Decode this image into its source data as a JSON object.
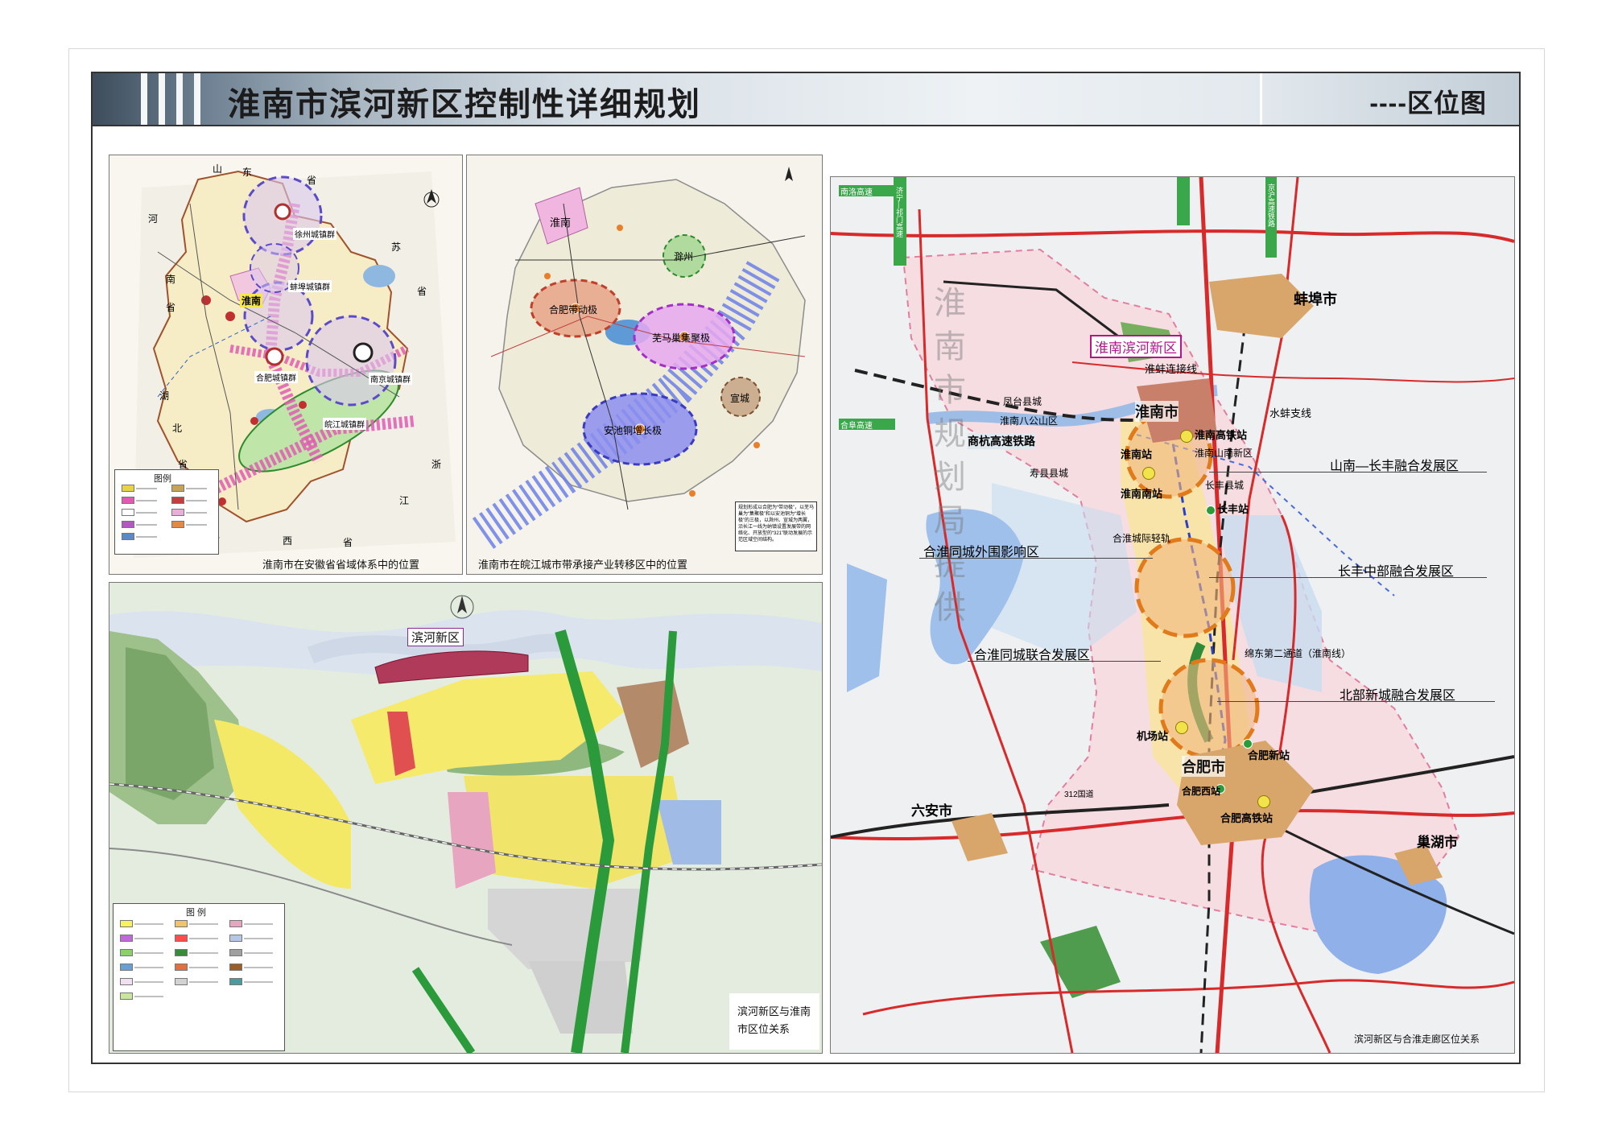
{
  "header": {
    "title": "淮南市滨河新区控制性详细规划",
    "subtitle": "----区位图"
  },
  "panel_province": {
    "caption": "淮南市在安徽省省域体系中的位置",
    "legend_title": "图例",
    "labels": {
      "shandong": "山",
      "dong": "东",
      "sheng1": "省",
      "henan1": "河",
      "henan2": "南",
      "sheng2": "省",
      "jiang1": "苏",
      "sheng3": "省",
      "hu": "湖",
      "bei": "北",
      "sheng4": "省",
      "zhe": "浙",
      "jiang2": "江",
      "jiangxi1": "江",
      "jiangxi2": "西",
      "sheng5": "省",
      "huainan": "淮南",
      "xuzhou": "徐州城镇群",
      "bengbu": "蚌埠城镇群",
      "hefei": "合肥城镇群",
      "nanjing": "南京城镇群",
      "wanjiang": "皖江城镇群"
    },
    "legend_items": [
      {
        "color": "#e8d24a"
      },
      {
        "color": "#c9a25a"
      },
      {
        "color": "#e05ab4"
      },
      {
        "color": "#c04040"
      },
      {
        "color": "#ffffff"
      },
      {
        "color": "#e6b0d8"
      },
      {
        "color": "#b05ac0"
      },
      {
        "color": "#e08a4a"
      },
      {
        "color": "#5a8ac0"
      }
    ]
  },
  "panel_wanjiang": {
    "caption": "淮南市在皖江城市带承接产业转移区中的位置",
    "labels": {
      "huainan": "淮南",
      "hefei_pole": "合肥带动极",
      "chuzhou": "滁州",
      "wuma": "芜马巢集聚极",
      "xuancheng": "宣城",
      "anchi": "安池铜增长极"
    },
    "note": "规划形成以合肥为“带动极”，以芜马巢为“集聚极”和以安池铜为“增长极”的三极，以滁州、宣城为两翼，沿长江一线为纳镇设置发展带的网络化、开放型的“321”联动发展的示范区域空间结构。"
  },
  "panel_binhe": {
    "caption_line1": "滨河新区与淮南",
    "caption_line2": "市区位关系",
    "label": "滨河新区",
    "legend_title": "图 例",
    "legend_items": [
      {
        "color": "#f7f35c"
      },
      {
        "color": "#f2c46a"
      },
      {
        "color": "#e8a5c0"
      },
      {
        "color": "#c06ad8"
      },
      {
        "color": "#ff4d4d"
      },
      {
        "color": "#b4c8e6"
      },
      {
        "color": "#8bd06a"
      },
      {
        "color": "#3b8a3b"
      },
      {
        "color": "#a0a0a0"
      },
      {
        "color": "#6aa0d0"
      },
      {
        "color": "#e07040"
      },
      {
        "color": "#9a5e2a"
      },
      {
        "color": "#f0e0f0"
      },
      {
        "color": "#d2d2d2"
      },
      {
        "color": "#4a9c9c"
      },
      {
        "color": "#c8e6a0"
      }
    ]
  },
  "panel_corridor": {
    "caption": "滨河新区与合淮走廊区位关系",
    "watermark": "淮南市规划局提供",
    "highlight": "淮南滨河新区",
    "cities": {
      "huainan": "淮南市",
      "bengbu": "蚌埠市",
      "hefei": "合肥市",
      "luan": "六安市",
      "chaohu": "巢湖市"
    },
    "stations": {
      "huainan_hsr": "淮南高铁站",
      "huainan": "淮南站",
      "huainan_south": "淮南南站",
      "changfeng": "长丰站",
      "airport": "机场站",
      "hefei_new": "合肥新站",
      "hefei_west": "合肥西站",
      "hefei_hsr": "合肥高铁站"
    },
    "places": {
      "shou_county": "寿县县城",
      "bagongshan": "淮南八公山区",
      "shannan_new": "淮南山南新区",
      "changfeng_county": "长丰县城",
      "fengtai": "凤台县城"
    },
    "lines": {
      "huaibeng": "淮蚌连接线",
      "shuibeng": "水蚌支线",
      "shanghang": "商杭高速铁路",
      "hehuai_light": "合淮城际轻轨",
      "jinan_expressway": "济宁—祁门高速",
      "jinghu_hsr": "京沪高速铁路",
      "hefu_highway": "合阜高速",
      "nanluo": "南洛高速",
      "hefei_second": "绵东第二通道（淮南线）",
      "road312": "312国道"
    },
    "zones": {
      "shannan_changfeng": "山南—长丰融合发展区",
      "hehuai_outer": "合淮同城外围影响区",
      "changfeng_central": "长丰中部融合发展区",
      "hehuai_joint": "合淮同城联合发展区",
      "north_new": "北部新城融合发展区"
    }
  }
}
